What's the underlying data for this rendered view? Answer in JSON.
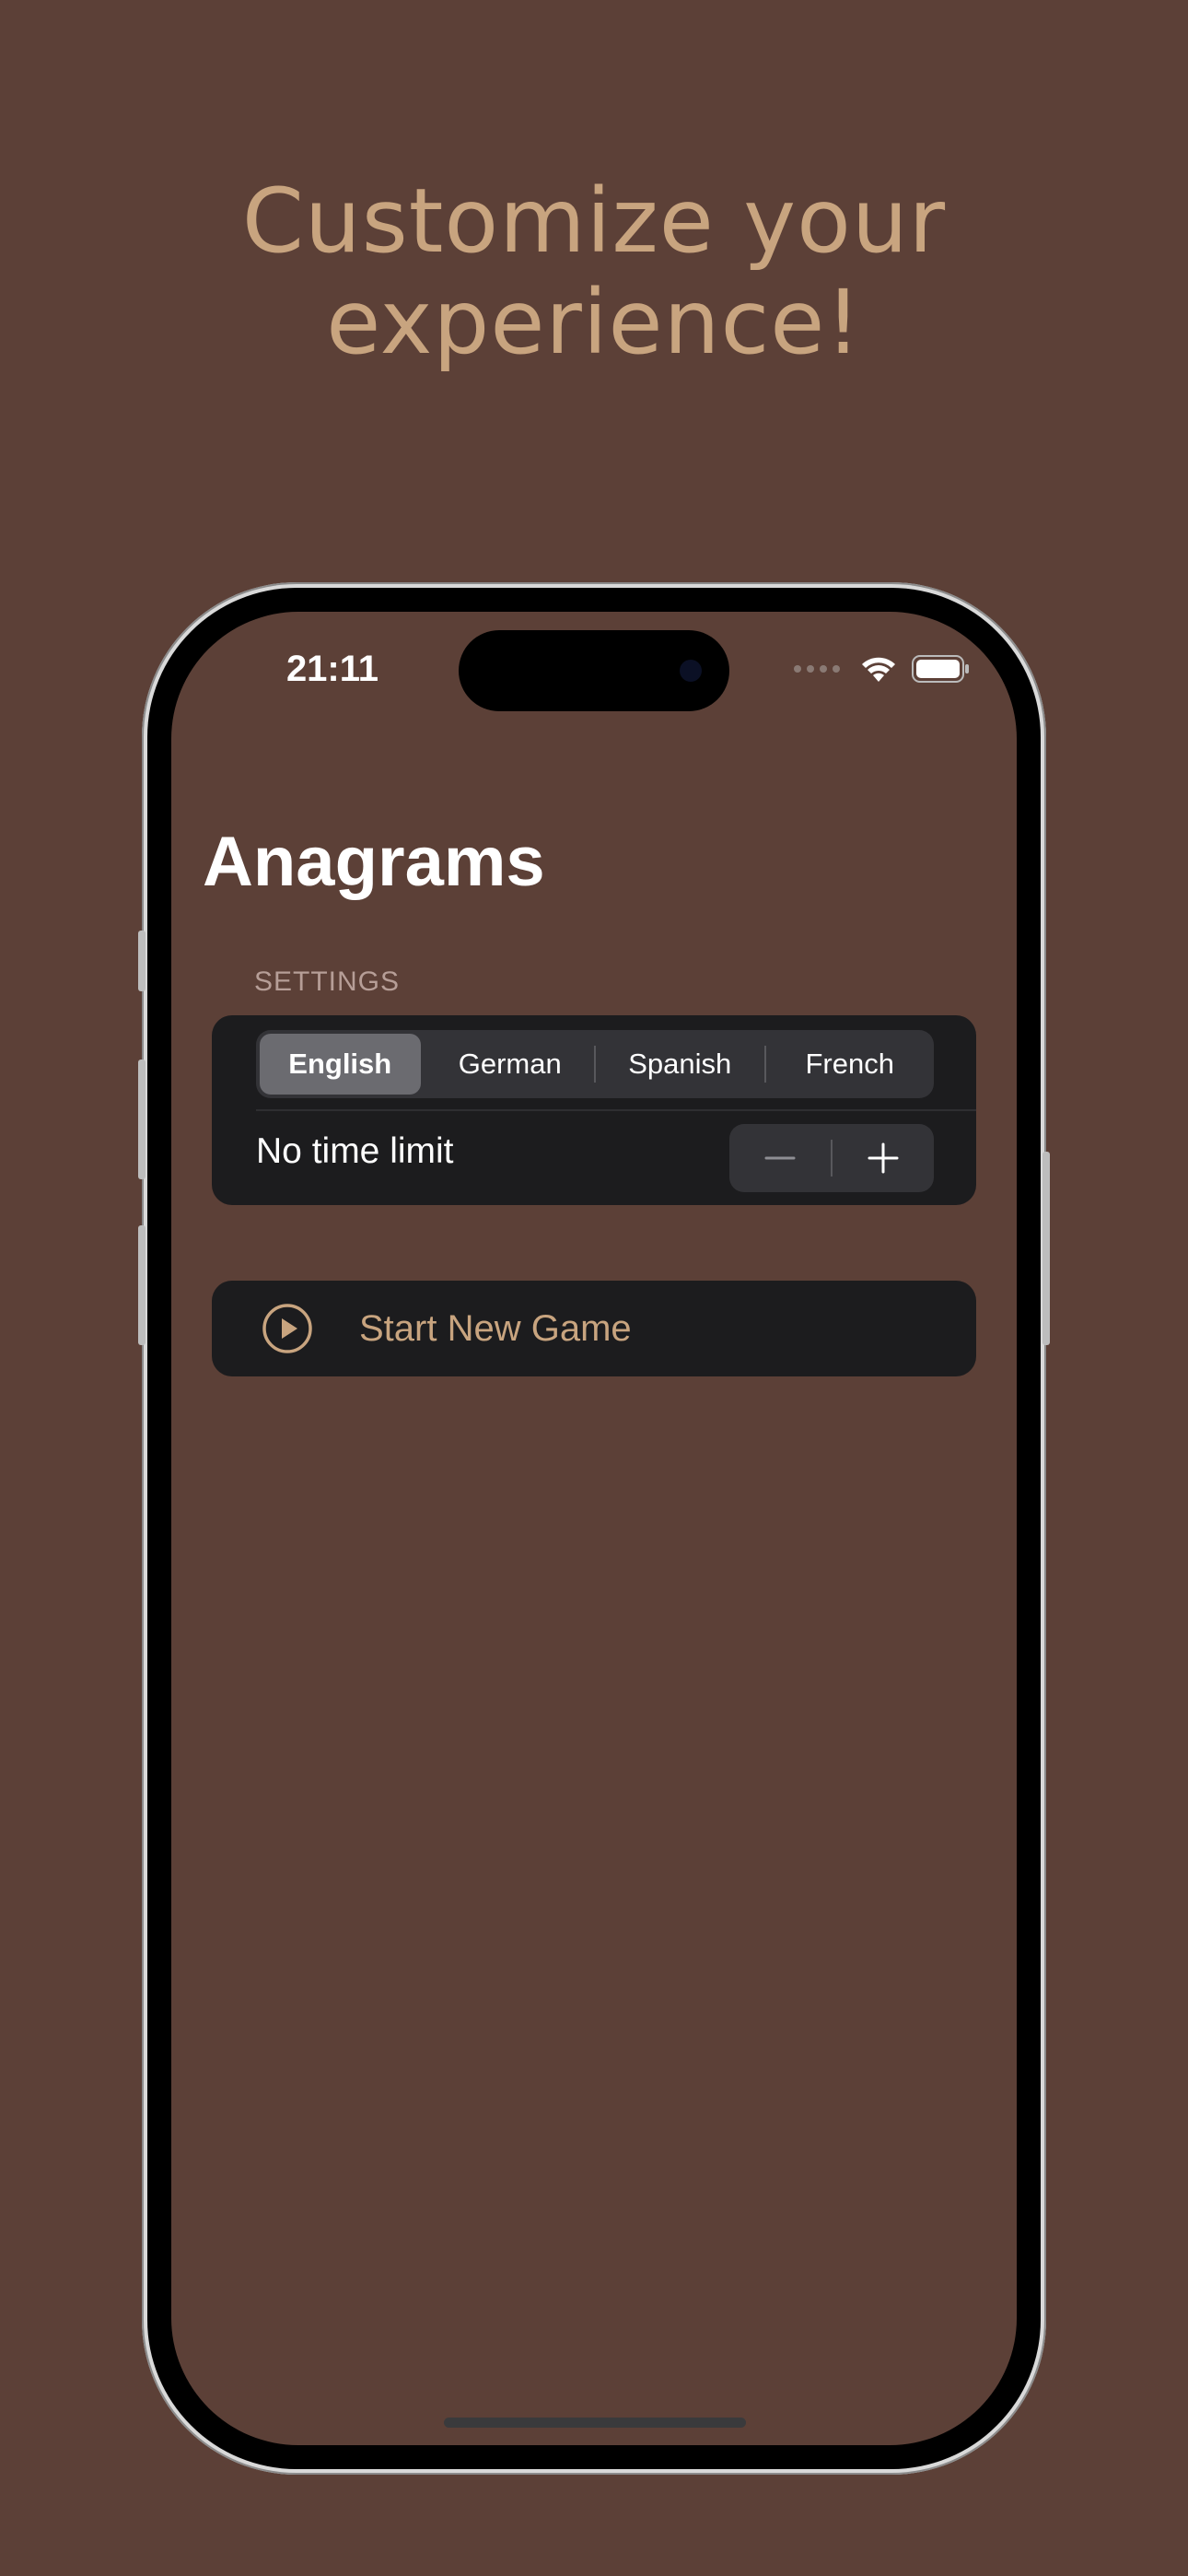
{
  "headline": {
    "line1": "Customize your",
    "line2": "experience!"
  },
  "status_bar": {
    "time": "21:11",
    "icons": [
      "signal-dots-icon",
      "wifi-icon",
      "battery-icon"
    ]
  },
  "app": {
    "title": "Anagrams",
    "settings_header": "SETTINGS",
    "language_options": [
      {
        "label": "English",
        "selected": true
      },
      {
        "label": "German",
        "selected": false
      },
      {
        "label": "Spanish",
        "selected": false
      },
      {
        "label": "French",
        "selected": false
      }
    ],
    "time_limit_label": "No time limit",
    "stepper": {
      "minus_icon": "minus-icon",
      "plus_icon": "plus-icon"
    },
    "start_button": {
      "label": "Start New Game",
      "icon": "play-circle-icon"
    }
  },
  "colors": {
    "background": "#5c4037",
    "accent": "#c8a47f",
    "card": "#1c1c1e",
    "segment_selected": "#6b6b70"
  }
}
